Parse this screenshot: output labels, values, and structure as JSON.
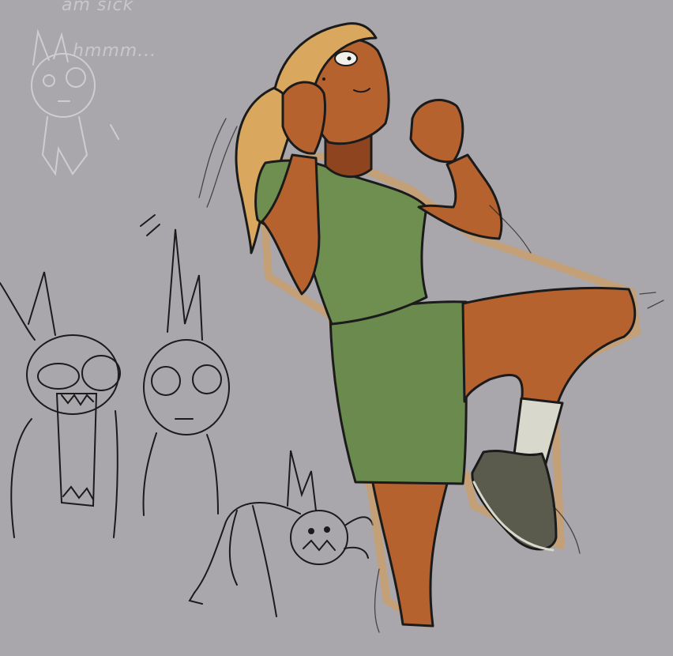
{
  "scribbles": {
    "top_note": "am sick",
    "hmm_note": "hmmm..."
  },
  "colors": {
    "background": "#a9a7ab",
    "skin": "#b5622f",
    "skin_shadow": "#8f4420",
    "hair": "#d9a85e",
    "shirt": "#6f8f50",
    "shorts": "#6b8a4e",
    "sock": "#d8d8cc",
    "shoe": "#5a5b4c",
    "outline": "#1b1b1b",
    "glow": "#d99a4e",
    "sketch_light": "#cfcdd2"
  }
}
